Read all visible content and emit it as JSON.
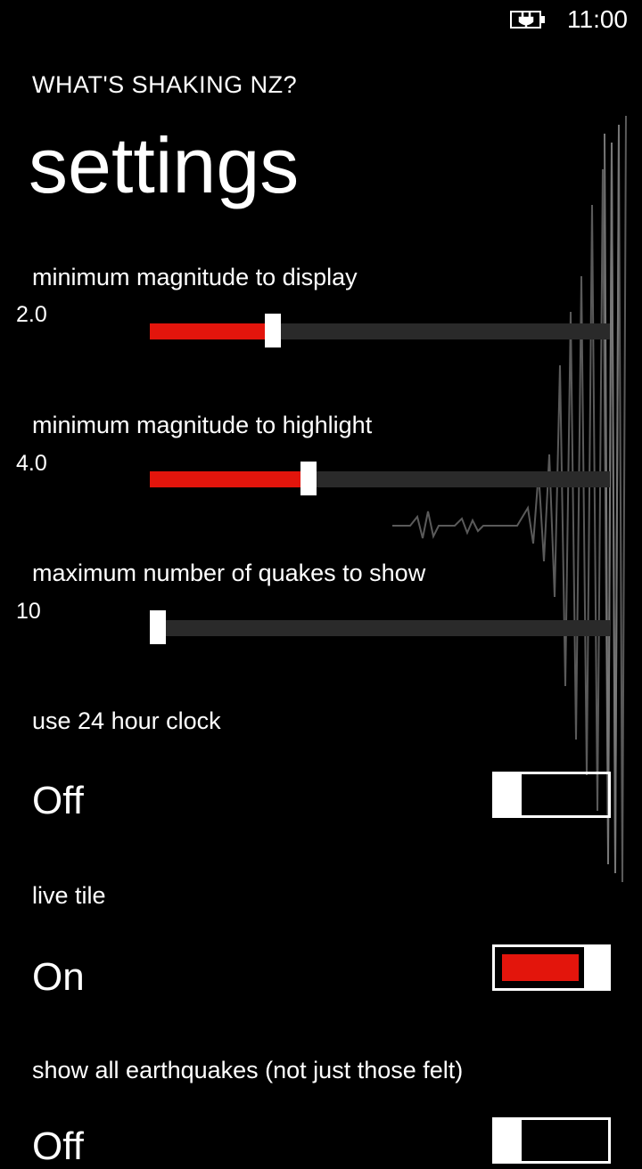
{
  "status": {
    "time": "11:00",
    "battery_icon": "battery-charging-icon"
  },
  "app": {
    "title": "WHAT'S SHAKING NZ?",
    "page_title": "settings"
  },
  "accent": "#e3150c",
  "settings": {
    "min_display": {
      "label": "minimum magnitude to display",
      "value": "2.0",
      "fraction": 0.26
    },
    "min_highlight": {
      "label": "minimum magnitude to highlight",
      "value": "4.0",
      "fraction": 0.34
    },
    "max_quakes": {
      "label": "maximum number of quakes to show",
      "value": "10",
      "fraction": 0.0
    },
    "clock24": {
      "label": "use 24 hour clock",
      "state": "Off",
      "on": false
    },
    "live_tile": {
      "label": "live tile",
      "state": "On",
      "on": true
    },
    "show_all": {
      "label": "show all earthquakes (not just those felt)",
      "state": "Off",
      "on": false
    }
  }
}
